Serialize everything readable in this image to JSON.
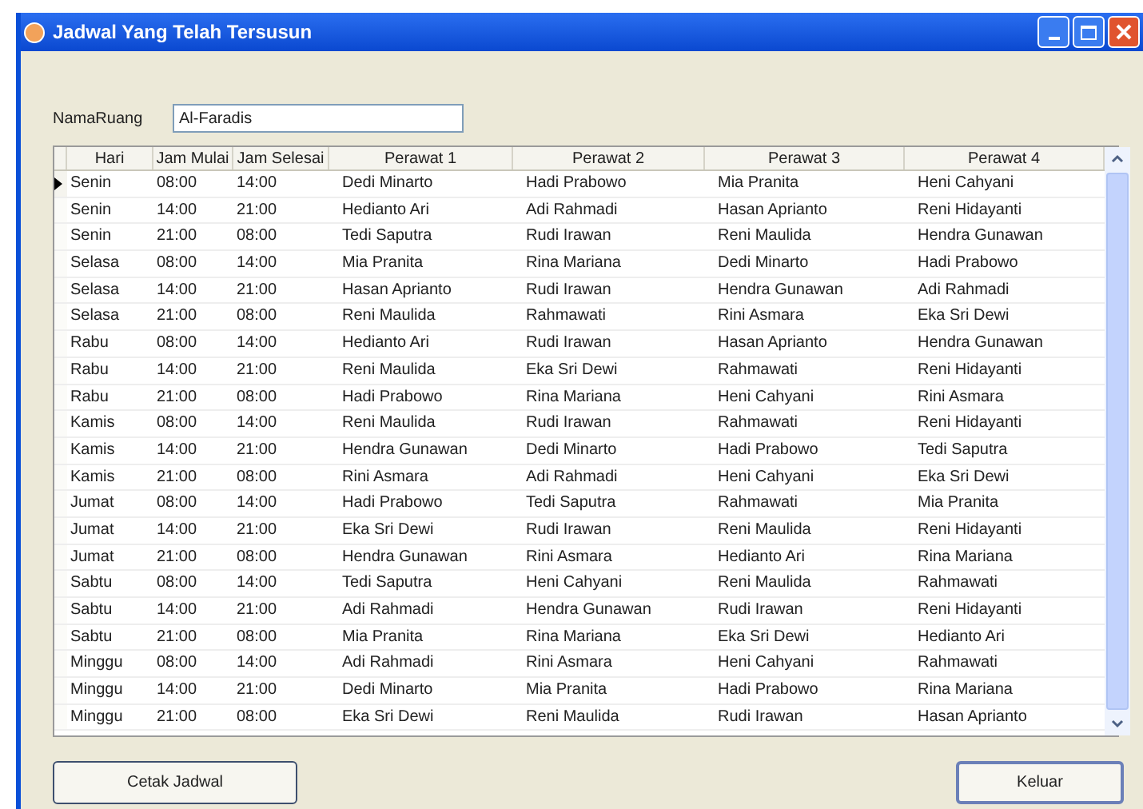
{
  "window": {
    "title": "Jadwal Yang Telah Tersusun"
  },
  "field": {
    "label": "NamaRuang",
    "value": "Al-Faradis"
  },
  "table": {
    "columns": [
      "Hari",
      "Jam Mulai",
      "Jam Selesai",
      "Perawat 1",
      "Perawat 2",
      "Perawat 3",
      "Perawat 4"
    ],
    "rows": [
      {
        "selected": true,
        "cells": [
          "Senin",
          "08:00",
          "14:00",
          "Dedi Minarto",
          "Hadi Prabowo",
          "Mia Pranita",
          "Heni Cahyani"
        ]
      },
      {
        "selected": false,
        "cells": [
          "Senin",
          "14:00",
          "21:00",
          "Hedianto Ari",
          "Adi Rahmadi",
          "Hasan Aprianto",
          "Reni Hidayanti"
        ]
      },
      {
        "selected": false,
        "cells": [
          "Senin",
          "21:00",
          "08:00",
          "Tedi Saputra",
          "Rudi Irawan",
          "Reni Maulida",
          "Hendra Gunawan"
        ]
      },
      {
        "selected": false,
        "cells": [
          "Selasa",
          "08:00",
          "14:00",
          "Mia Pranita",
          "Rina Mariana",
          "Dedi Minarto",
          "Hadi Prabowo"
        ]
      },
      {
        "selected": false,
        "cells": [
          "Selasa",
          "14:00",
          "21:00",
          "Hasan Aprianto",
          "Rudi Irawan",
          "Hendra Gunawan",
          "Adi Rahmadi"
        ]
      },
      {
        "selected": false,
        "cells": [
          "Selasa",
          "21:00",
          "08:00",
          "Reni Maulida",
          "Rahmawati",
          "Rini Asmara",
          "Eka Sri Dewi"
        ]
      },
      {
        "selected": false,
        "cells": [
          "Rabu",
          "08:00",
          "14:00",
          "Hedianto Ari",
          "Rudi Irawan",
          "Hasan Aprianto",
          "Hendra Gunawan"
        ]
      },
      {
        "selected": false,
        "cells": [
          "Rabu",
          "14:00",
          "21:00",
          "Reni Maulida",
          "Eka Sri Dewi",
          "Rahmawati",
          "Reni Hidayanti"
        ]
      },
      {
        "selected": false,
        "cells": [
          "Rabu",
          "21:00",
          "08:00",
          "Hadi Prabowo",
          "Rina Mariana",
          "Heni Cahyani",
          "Rini Asmara"
        ]
      },
      {
        "selected": false,
        "cells": [
          "Kamis",
          "08:00",
          "14:00",
          "Reni Maulida",
          "Rudi Irawan",
          "Rahmawati",
          "Reni Hidayanti"
        ]
      },
      {
        "selected": false,
        "cells": [
          "Kamis",
          "14:00",
          "21:00",
          "Hendra Gunawan",
          "Dedi Minarto",
          "Hadi Prabowo",
          "Tedi Saputra"
        ]
      },
      {
        "selected": false,
        "cells": [
          "Kamis",
          "21:00",
          "08:00",
          "Rini Asmara",
          "Adi Rahmadi",
          "Heni Cahyani",
          "Eka Sri Dewi"
        ]
      },
      {
        "selected": false,
        "cells": [
          "Jumat",
          "08:00",
          "14:00",
          "Hadi Prabowo",
          "Tedi Saputra",
          "Rahmawati",
          "Mia Pranita"
        ]
      },
      {
        "selected": false,
        "cells": [
          "Jumat",
          "14:00",
          "21:00",
          "Eka Sri Dewi",
          "Rudi Irawan",
          "Reni Maulida",
          "Reni Hidayanti"
        ]
      },
      {
        "selected": false,
        "cells": [
          "Jumat",
          "21:00",
          "08:00",
          "Hendra Gunawan",
          "Rini Asmara",
          "Hedianto Ari",
          "Rina Mariana"
        ]
      },
      {
        "selected": false,
        "cells": [
          "Sabtu",
          "08:00",
          "14:00",
          "Tedi Saputra",
          "Heni Cahyani",
          "Reni Maulida",
          "Rahmawati"
        ]
      },
      {
        "selected": false,
        "cells": [
          "Sabtu",
          "14:00",
          "21:00",
          "Adi Rahmadi",
          "Hendra Gunawan",
          "Rudi Irawan",
          "Reni Hidayanti"
        ]
      },
      {
        "selected": false,
        "cells": [
          "Sabtu",
          "21:00",
          "08:00",
          "Mia Pranita",
          "Rina Mariana",
          "Eka Sri Dewi",
          "Hedianto Ari"
        ]
      },
      {
        "selected": false,
        "cells": [
          "Minggu",
          "08:00",
          "14:00",
          "Adi Rahmadi",
          "Rini Asmara",
          "Heni Cahyani",
          "Rahmawati"
        ]
      },
      {
        "selected": false,
        "cells": [
          "Minggu",
          "14:00",
          "21:00",
          "Dedi Minarto",
          "Mia Pranita",
          "Hadi Prabowo",
          "Rina Mariana"
        ]
      },
      {
        "selected": false,
        "cells": [
          "Minggu",
          "21:00",
          "08:00",
          "Eka Sri Dewi",
          "Reni Maulida",
          "Rudi Irawan",
          "Hasan Aprianto"
        ]
      }
    ]
  },
  "buttons": [
    "Cetak Jadwal",
    "Keluar"
  ]
}
